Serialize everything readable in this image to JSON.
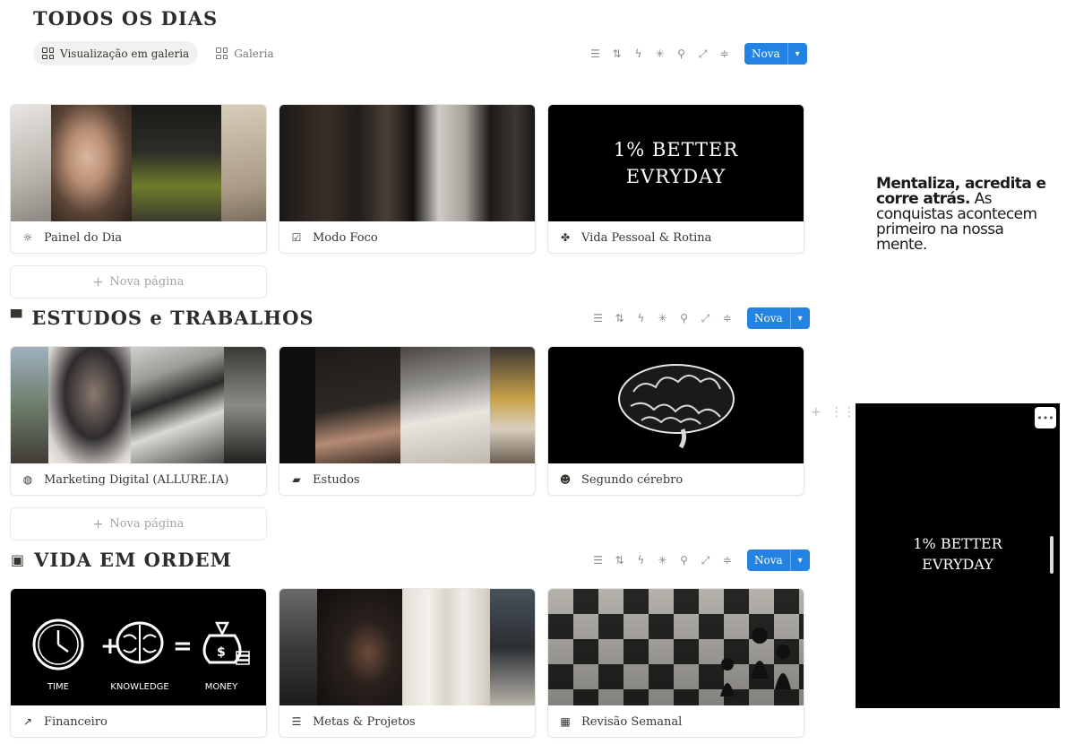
{
  "sections": [
    {
      "title": "TODOS OS DIAS",
      "icon": ""
    },
    {
      "title": "ESTUDOS e TRABALHOS",
      "icon": "monitor-icon"
    },
    {
      "title": "VIDA EM ORDEM",
      "icon": "money-icon"
    }
  ],
  "views": {
    "active": "Visualização em galeria",
    "secondary": "Galeria"
  },
  "toolbar": {
    "new_label": "Nova",
    "icons": [
      "filter-icon",
      "sort-icon",
      "automation-icon",
      "loading-icon",
      "search-icon",
      "expand-icon",
      "settings-icon",
      "chevron-down-icon"
    ]
  },
  "new_page_label": "Nova página",
  "cards": {
    "painel": {
      "label": "Painel do Dia",
      "icon": "sun-icon"
    },
    "foco": {
      "label": "Modo Foco",
      "icon": "checklist-icon"
    },
    "vida": {
      "label": "Vida Pessoal & Rotina",
      "icon": "clover-icon",
      "cover_line1": "1% BETTER",
      "cover_line2": "EVRYDAY"
    },
    "marketing": {
      "label": "Marketing Digital (ALLURE.IA)",
      "icon": "globe-icon"
    },
    "estudos": {
      "label": "Estudos",
      "icon": "book-icon"
    },
    "cerebro": {
      "label": "Segundo cérebro",
      "icon": "head-icon"
    },
    "financeiro": {
      "label": "Financeiro",
      "icon": "chart-icon",
      "cover_words": [
        "TIME",
        "KNOWLEDGE",
        "MONEY"
      ]
    },
    "metas": {
      "label": "Metas & Projetos",
      "icon": "list-icon"
    },
    "revisao": {
      "label": "Revisão Semanal",
      "icon": "calendar-icon"
    }
  },
  "quote": {
    "bold": "Mentaliza, acredita e corre atrás.",
    "rest": " As conquistas acontecem primeiro na nossa mente."
  },
  "embed": {
    "line1": "1% BETTER",
    "line2": "EVRYDAY"
  }
}
